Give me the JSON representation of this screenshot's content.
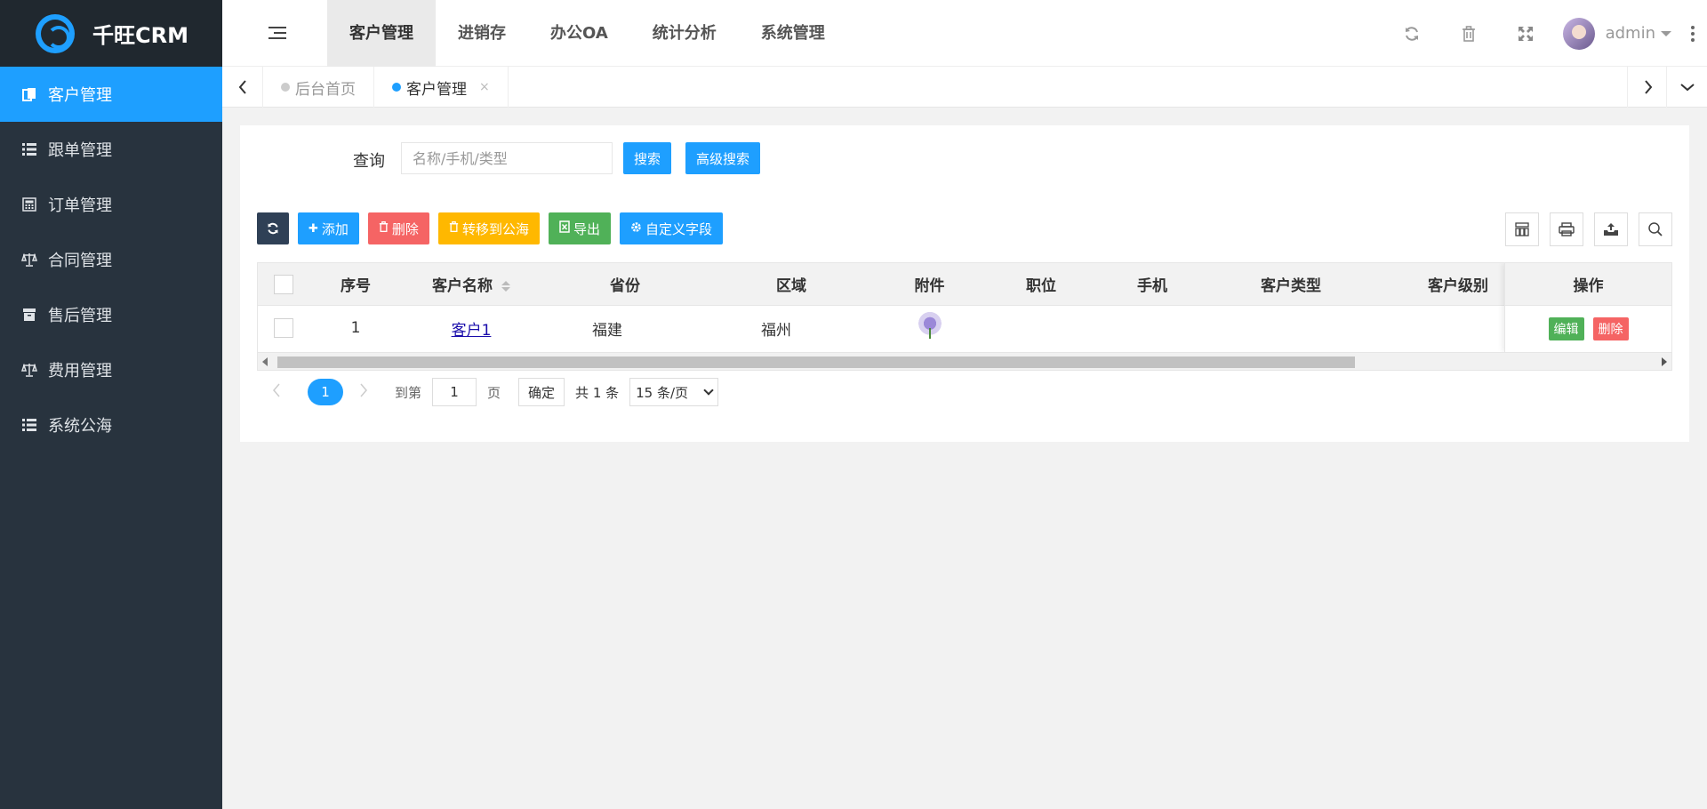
{
  "app": {
    "logo_text": "千旺CRM"
  },
  "sidebar": {
    "items": [
      {
        "label": "客户管理",
        "icon": "contacts-icon",
        "active": true
      },
      {
        "label": "跟单管理",
        "icon": "list-icon"
      },
      {
        "label": "订单管理",
        "icon": "calculator-icon"
      },
      {
        "label": "合同管理",
        "icon": "scale-icon"
      },
      {
        "label": "售后管理",
        "icon": "archive-icon"
      },
      {
        "label": "费用管理",
        "icon": "scale-icon"
      },
      {
        "label": "系统公海",
        "icon": "list-icon"
      }
    ]
  },
  "header": {
    "nav": [
      {
        "label": "客户管理",
        "active": true
      },
      {
        "label": "进销存"
      },
      {
        "label": "办公OA"
      },
      {
        "label": "统计分析"
      },
      {
        "label": "系统管理"
      }
    ],
    "tools": [
      "refresh-icon",
      "trash-icon",
      "fullscreen-icon"
    ],
    "user_name": "admin"
  },
  "tabs": [
    {
      "label": "后台首页",
      "active": false
    },
    {
      "label": "客户管理",
      "active": true,
      "closable": true,
      "close": "×"
    }
  ],
  "search": {
    "label": "查询",
    "placeholder": "名称/手机/类型",
    "search_btn": "搜索",
    "advanced_btn": "高级搜索"
  },
  "toolbar": {
    "add": "添加",
    "delete": "删除",
    "transfer": "转移到公海",
    "export": "导出",
    "custom_fields": "自定义字段"
  },
  "table": {
    "headers": [
      "序号",
      "客户名称",
      "省份",
      "区域",
      "附件",
      "职位",
      "手机",
      "客户类型",
      "客户级别"
    ],
    "action_header": "操作",
    "rows": [
      {
        "index": "1",
        "name": "客户1",
        "province": "福建",
        "area": "福州",
        "position": "",
        "phone": "",
        "type": "",
        "level": ""
      }
    ],
    "edit_btn": "编辑",
    "delete_btn": "删除"
  },
  "pager": {
    "current": "1",
    "goto_label": "到第",
    "goto_value": "1",
    "page_unit": "页",
    "confirm": "确定",
    "total": "共 1 条",
    "page_size": "15 条/页"
  }
}
